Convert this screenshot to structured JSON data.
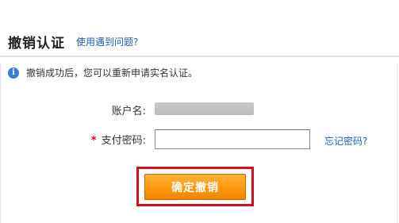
{
  "header": {
    "title": "撤销认证",
    "help_link": "使用遇到问题?"
  },
  "info": {
    "icon": "info-icon",
    "message": "撤销成功后，您可以重新申请实名认证。"
  },
  "form": {
    "account_label": "账户名:",
    "password_required_mark": "*",
    "password_label": "支付密码:",
    "password_value": "",
    "forgot_link": "忘记密码?",
    "confirm_button": "确定撤销"
  },
  "colors": {
    "link": "#1f5fb3",
    "button": "#ff9a10",
    "highlight_border": "#d0101f",
    "required": "#e6001a"
  }
}
